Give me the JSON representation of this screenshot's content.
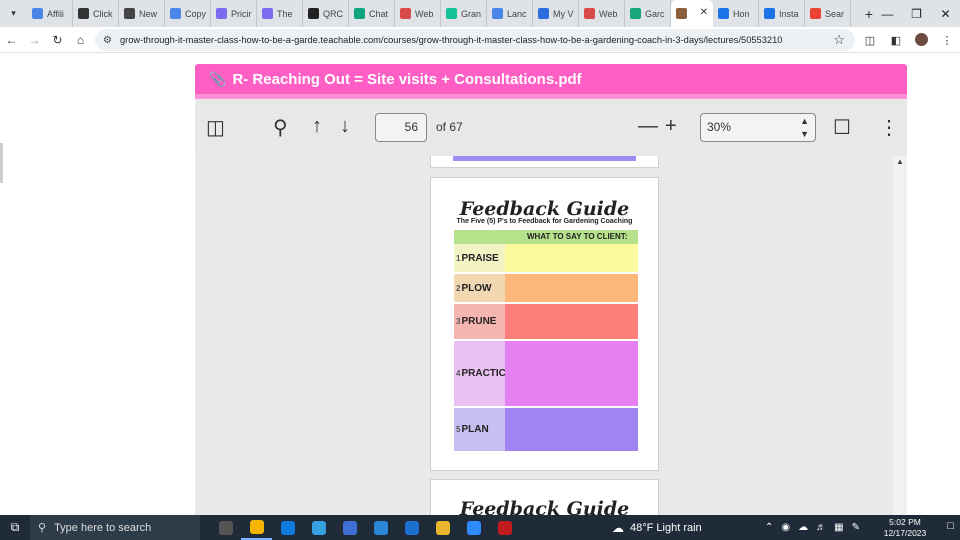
{
  "browser": {
    "tabs": [
      {
        "label": "Affili",
        "color": "#4a86e8"
      },
      {
        "label": "Click",
        "color": "#333333"
      },
      {
        "label": "New",
        "color": "#444444"
      },
      {
        "label": "Copy",
        "color": "#4a86e8"
      },
      {
        "label": "Pricir",
        "color": "#7c6cf0"
      },
      {
        "label": "The",
        "color": "#7c6cf0"
      },
      {
        "label": "QRC",
        "color": "#222222"
      },
      {
        "label": "Chat",
        "color": "#10a37f"
      },
      {
        "label": "Web",
        "color": "#d94b4b"
      },
      {
        "label": "Gran",
        "color": "#15c39a"
      },
      {
        "label": "Lanc",
        "color": "#4a86e8"
      },
      {
        "label": "My V",
        "color": "#2d6cdf"
      },
      {
        "label": "Web",
        "color": "#d94b4b"
      },
      {
        "label": "Garc",
        "color": "#15a67a"
      },
      {
        "label": "",
        "color": "#8b5e3c",
        "active": true
      },
      {
        "label": "Hon",
        "color": "#1a73e8"
      },
      {
        "label": "Insta",
        "color": "#1a73e8"
      },
      {
        "label": "Sear",
        "color": "#ea4335"
      }
    ],
    "url": "grow-through-it-master-class-how-to-be-a-garde.teachable.com/courses/grow-through-it-master-class-how-to-be-a-gardening-coach-in-3-days/lectures/50553210"
  },
  "viewer": {
    "title": "R- Reaching Out = Site visits + Consultations.pdf",
    "current_page": "56",
    "page_count_label": "of 67",
    "zoom": "30%"
  },
  "document": {
    "heading": "Feedback Guide",
    "subheading": "The Five (5) P's to Feedback for Gardening Coaching",
    "column_header": "WHAT TO SAY TO CLIENT:",
    "rows": [
      {
        "num": "1",
        "label": "PRAISE",
        "label_bg": "#f3f3c4",
        "value_bg": "#fbfb9e",
        "height": 30
      },
      {
        "num": "2",
        "label": "PLOW",
        "label_bg": "#f2d7b3",
        "value_bg": "#fdb77a",
        "height": 30
      },
      {
        "num": "3",
        "label": "PRUNE",
        "label_bg": "#f5b5b0",
        "value_bg": "#fd7f7c",
        "height": 37
      },
      {
        "num": "4",
        "label": "PRACTICE",
        "label_bg": "#eac1f2",
        "value_bg": "#e580f2",
        "height": 67
      },
      {
        "num": "5",
        "label": "PLAN",
        "label_bg": "#c7bff2",
        "value_bg": "#a084f2",
        "height": 45
      }
    ],
    "next_heading": "Feedback Guide"
  },
  "taskbar": {
    "search_placeholder": "Type here to search",
    "weather": "48°F  Light rain",
    "time": "5:02 PM",
    "date": "12/17/2023",
    "apps": [
      "#555555",
      "#f4b400",
      "#0f7be0",
      "#37a0e0",
      "#3f6fd6",
      "#2b88d8",
      "#1d6fd1",
      "#e8b52c",
      "#2d8cff",
      "#c21b1b"
    ]
  }
}
